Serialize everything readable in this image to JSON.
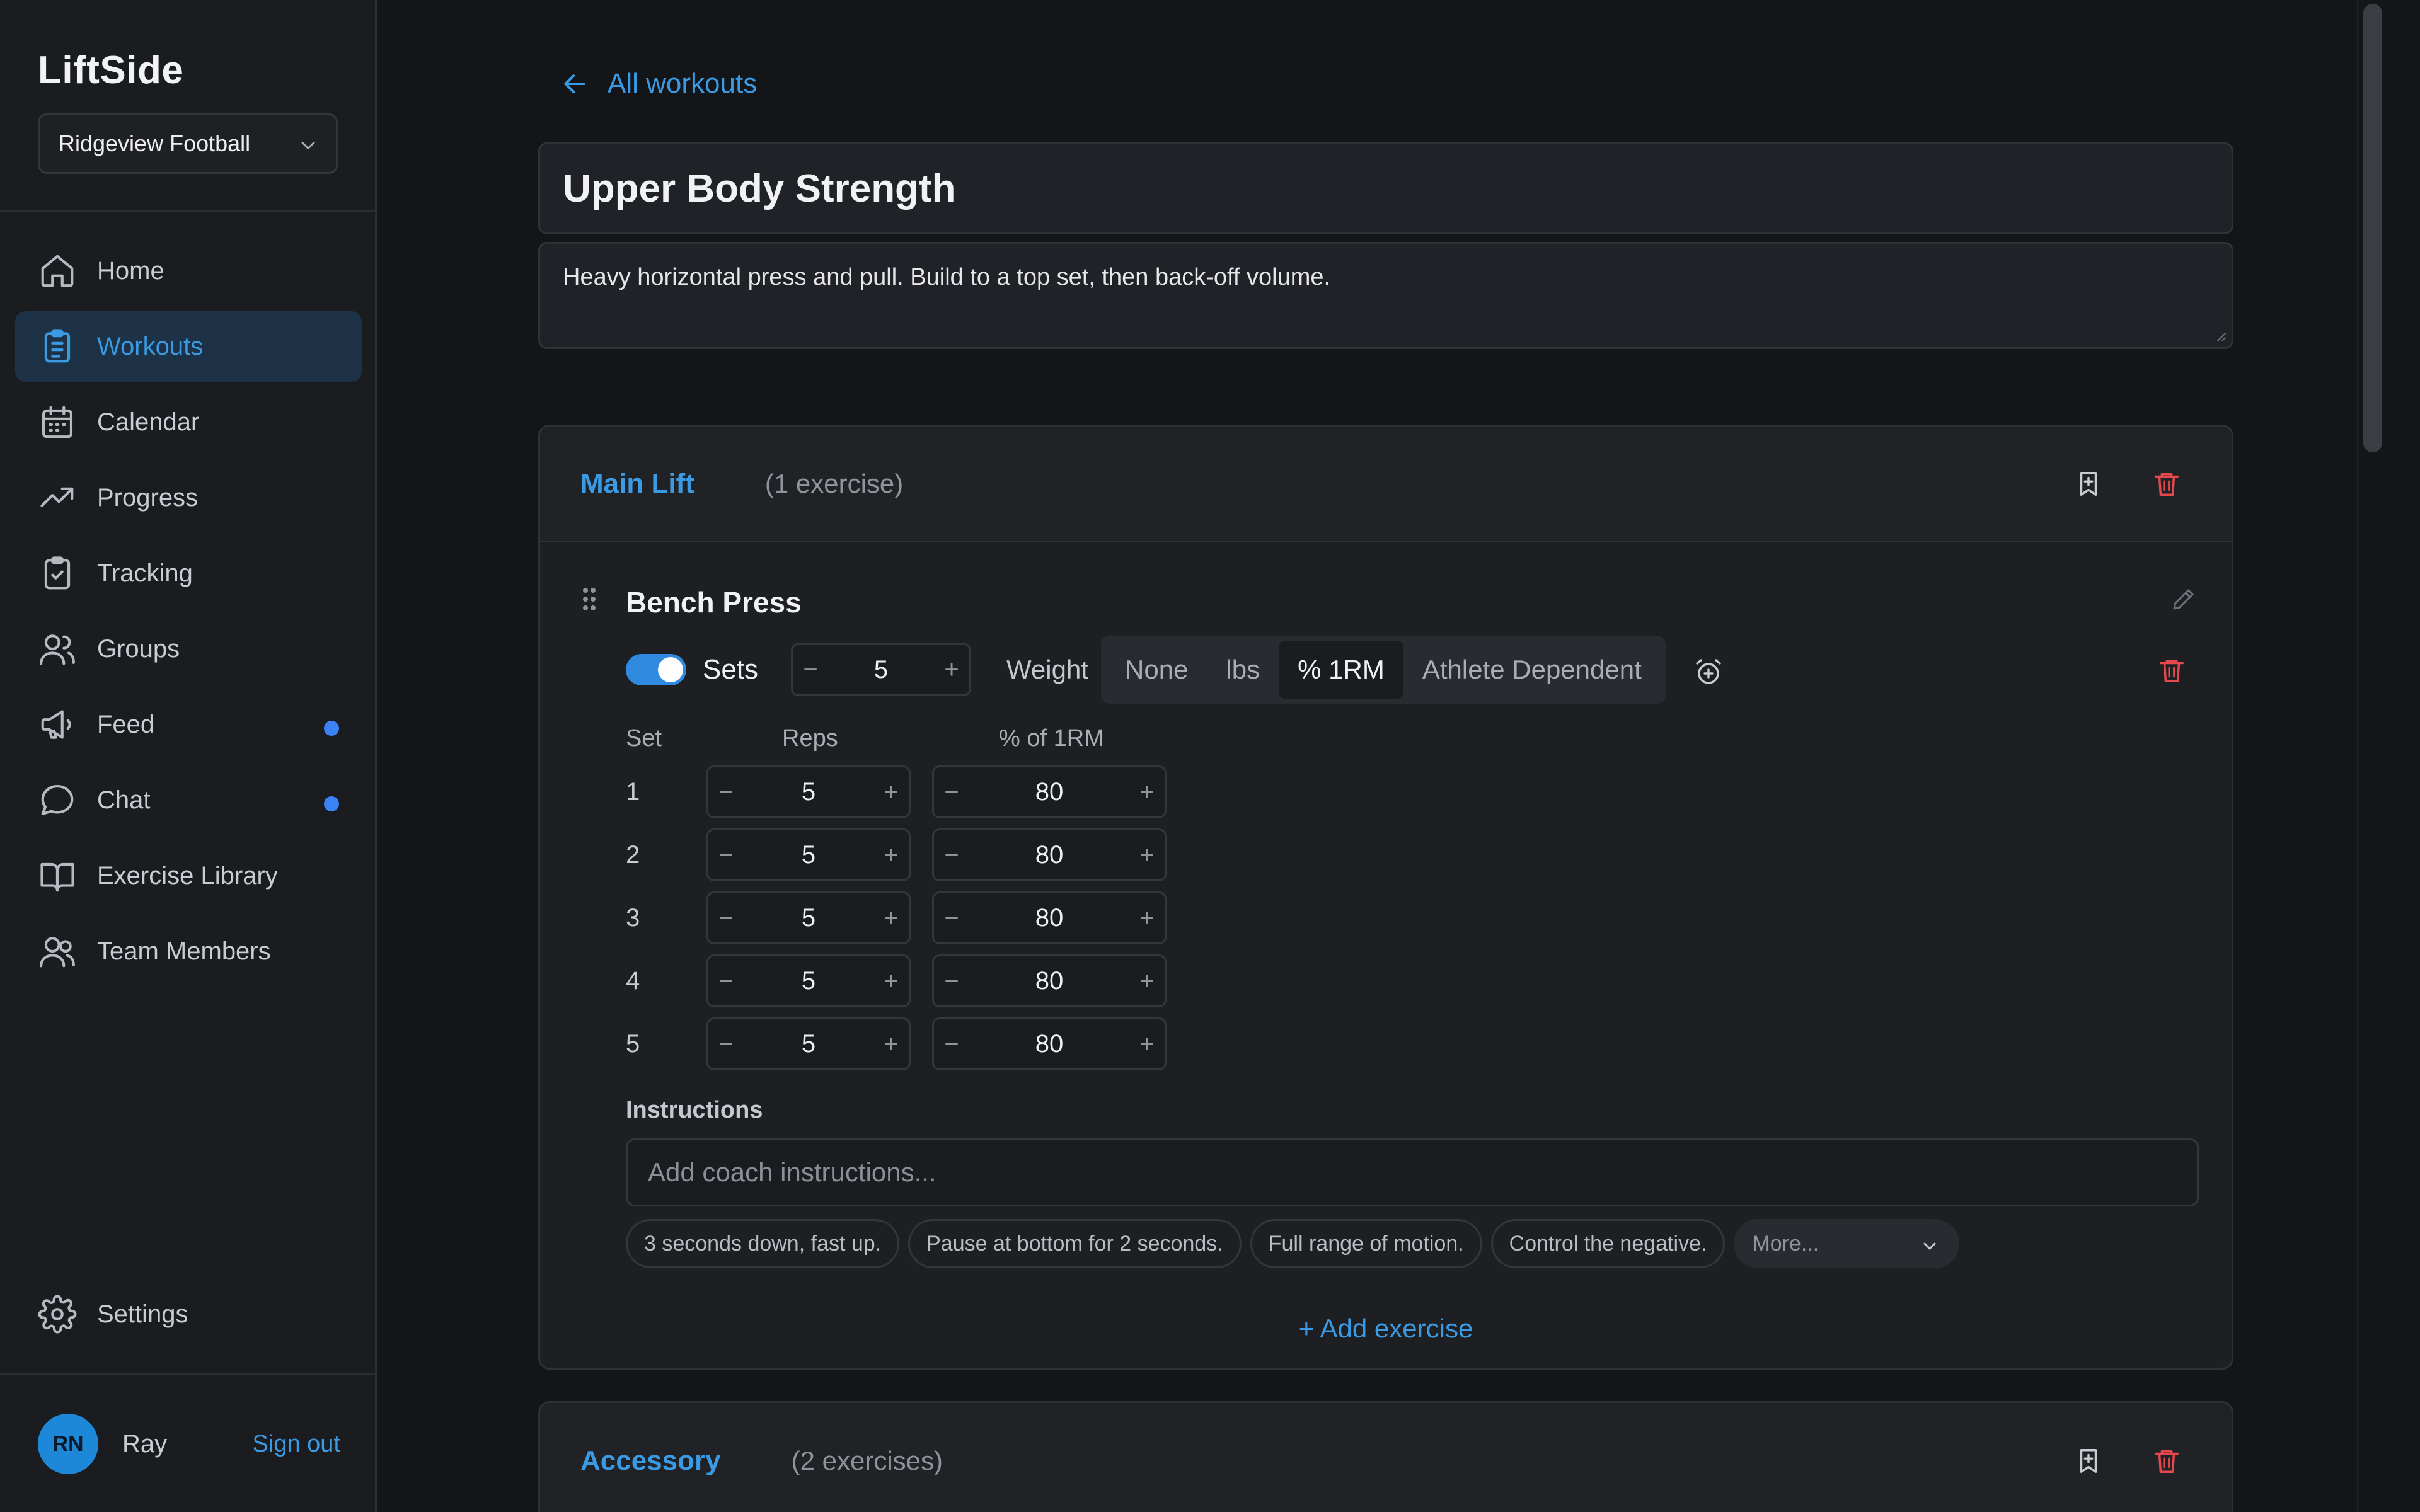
{
  "app": {
    "name": "LiftSide",
    "team": "Ridgeview Football"
  },
  "sidebar": {
    "items": [
      {
        "label": "Home",
        "icon": "home-icon"
      },
      {
        "label": "Workouts",
        "icon": "clipboard-list-icon"
      },
      {
        "label": "Calendar",
        "icon": "calendar-icon"
      },
      {
        "label": "Progress",
        "icon": "trending-up-icon"
      },
      {
        "label": "Tracking",
        "icon": "clipboard-check-icon"
      },
      {
        "label": "Groups",
        "icon": "users-icon"
      },
      {
        "label": "Feed",
        "icon": "megaphone-icon"
      },
      {
        "label": "Chat",
        "icon": "chat-bubble-icon"
      },
      {
        "label": "Exercise Library",
        "icon": "book-open-icon"
      },
      {
        "label": "Team Members",
        "icon": "team-members-icon"
      }
    ],
    "settings_label": "Settings",
    "user": {
      "initials": "RN",
      "name": "Ray",
      "sign_out": "Sign out"
    },
    "accent": "#3a9be4",
    "notification_color": "#3b82f6"
  },
  "workout": {
    "back_label": "All workouts",
    "title": "Upper Body Strength",
    "description": "Heavy horizontal press and pull. Build to a top set, then back-off volume."
  },
  "sections": [
    {
      "name": "Main Lift",
      "count": "(1 exercise)",
      "exercise": {
        "name": "Bench Press",
        "sets_label": "Sets",
        "sets_enabled": true,
        "sets_value": "5",
        "weight_label": "Weight",
        "weight_options": [
          "None",
          "lbs",
          "% 1RM",
          "Athlete Dependent"
        ],
        "weight_selected": "% 1RM",
        "columns": {
          "set": "Set",
          "reps": "Reps",
          "pct": "% of 1RM"
        },
        "rows": [
          {
            "set": "1",
            "reps": "5",
            "pct": "80"
          },
          {
            "set": "2",
            "reps": "5",
            "pct": "80"
          },
          {
            "set": "3",
            "reps": "5",
            "pct": "80"
          },
          {
            "set": "4",
            "reps": "5",
            "pct": "80"
          },
          {
            "set": "5",
            "reps": "5",
            "pct": "80"
          }
        ],
        "instructions_label": "Instructions",
        "instructions_placeholder": "Add coach instructions...",
        "chips": [
          "3 seconds down, fast up.",
          "Pause at bottom for 2 seconds.",
          "Full range of motion.",
          "Control the negative."
        ],
        "more_label": "More..."
      },
      "add_exercise": "+ Add exercise"
    },
    {
      "name": "Accessory",
      "count": "(2 exercises)"
    }
  ],
  "colors": {
    "danger": "#e5484d",
    "accent": "#3a9be4"
  }
}
